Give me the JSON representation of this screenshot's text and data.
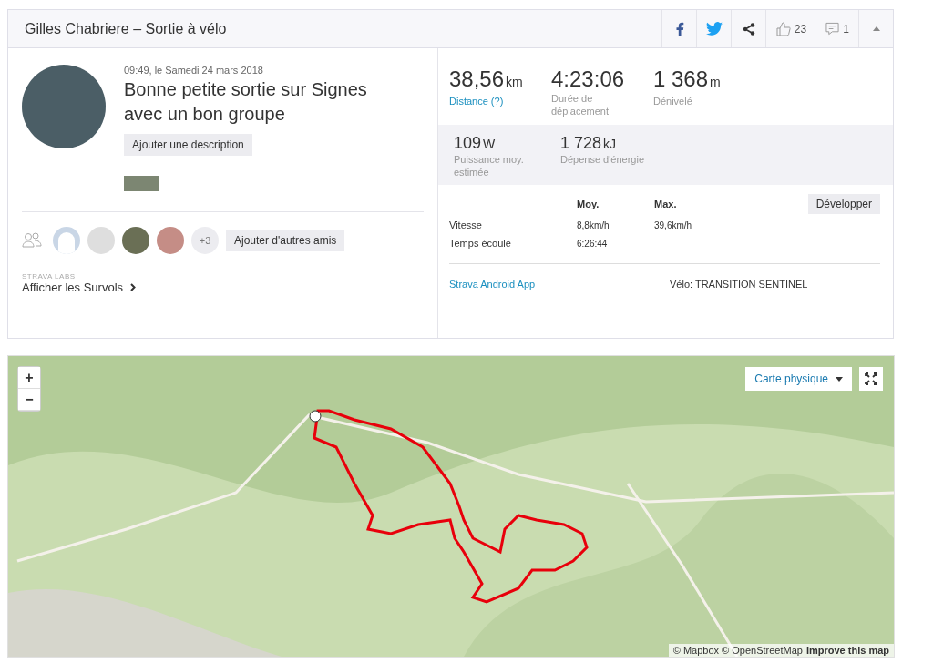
{
  "header": {
    "title": "Gilles Chabriere – Sortie à vélo",
    "kudos": "23",
    "comments": "1"
  },
  "activity": {
    "datetime": "09:49, le Samedi 24 mars 2018",
    "title": "Bonne petite sortie sur Signes avec un bon groupe",
    "add_description": "Ajouter une description"
  },
  "friends": {
    "more": "+3",
    "add_button": "Ajouter d'autres amis",
    "avatars": [
      {
        "kind": "blank"
      },
      {
        "kind": "grey"
      },
      {
        "kind": "photo"
      },
      {
        "kind": "photo"
      }
    ]
  },
  "labs": {
    "caption": "STRAVA LABS",
    "link": "Afficher les Survols"
  },
  "primary_stats": [
    {
      "value": "38,56",
      "unit": "km",
      "label": "Distance (?)",
      "kind": "link"
    },
    {
      "value": "4:23:06",
      "label": "Durée de déplacement",
      "kind": "plain"
    },
    {
      "value": "1 368",
      "unit": "m",
      "label": "Dénivelé",
      "kind": "plain"
    }
  ],
  "secondary_stats": [
    {
      "value": "109",
      "unit": "W",
      "label": "Puissance moy. estimée"
    },
    {
      "value": "1 728",
      "unit": "kJ",
      "label": "Dépense d'énergie"
    }
  ],
  "table": {
    "columns": [
      "Moy.",
      "Max."
    ],
    "expand_button": "Développer",
    "rows": [
      {
        "label": "Vitesse",
        "avg": "8,8km/h",
        "max": "39,6km/h"
      },
      {
        "label": "Temps écoulé",
        "avg": "6:26:44"
      }
    ]
  },
  "device": "Strava Android App",
  "bike": "Vélo: TRANSITION SENTINEL",
  "map": {
    "zoom_in": "+",
    "zoom_out": "−",
    "style_select": "Carte physique",
    "attribution": "© Mapbox © OpenStreetMap",
    "improve_link": "Improve this map"
  }
}
